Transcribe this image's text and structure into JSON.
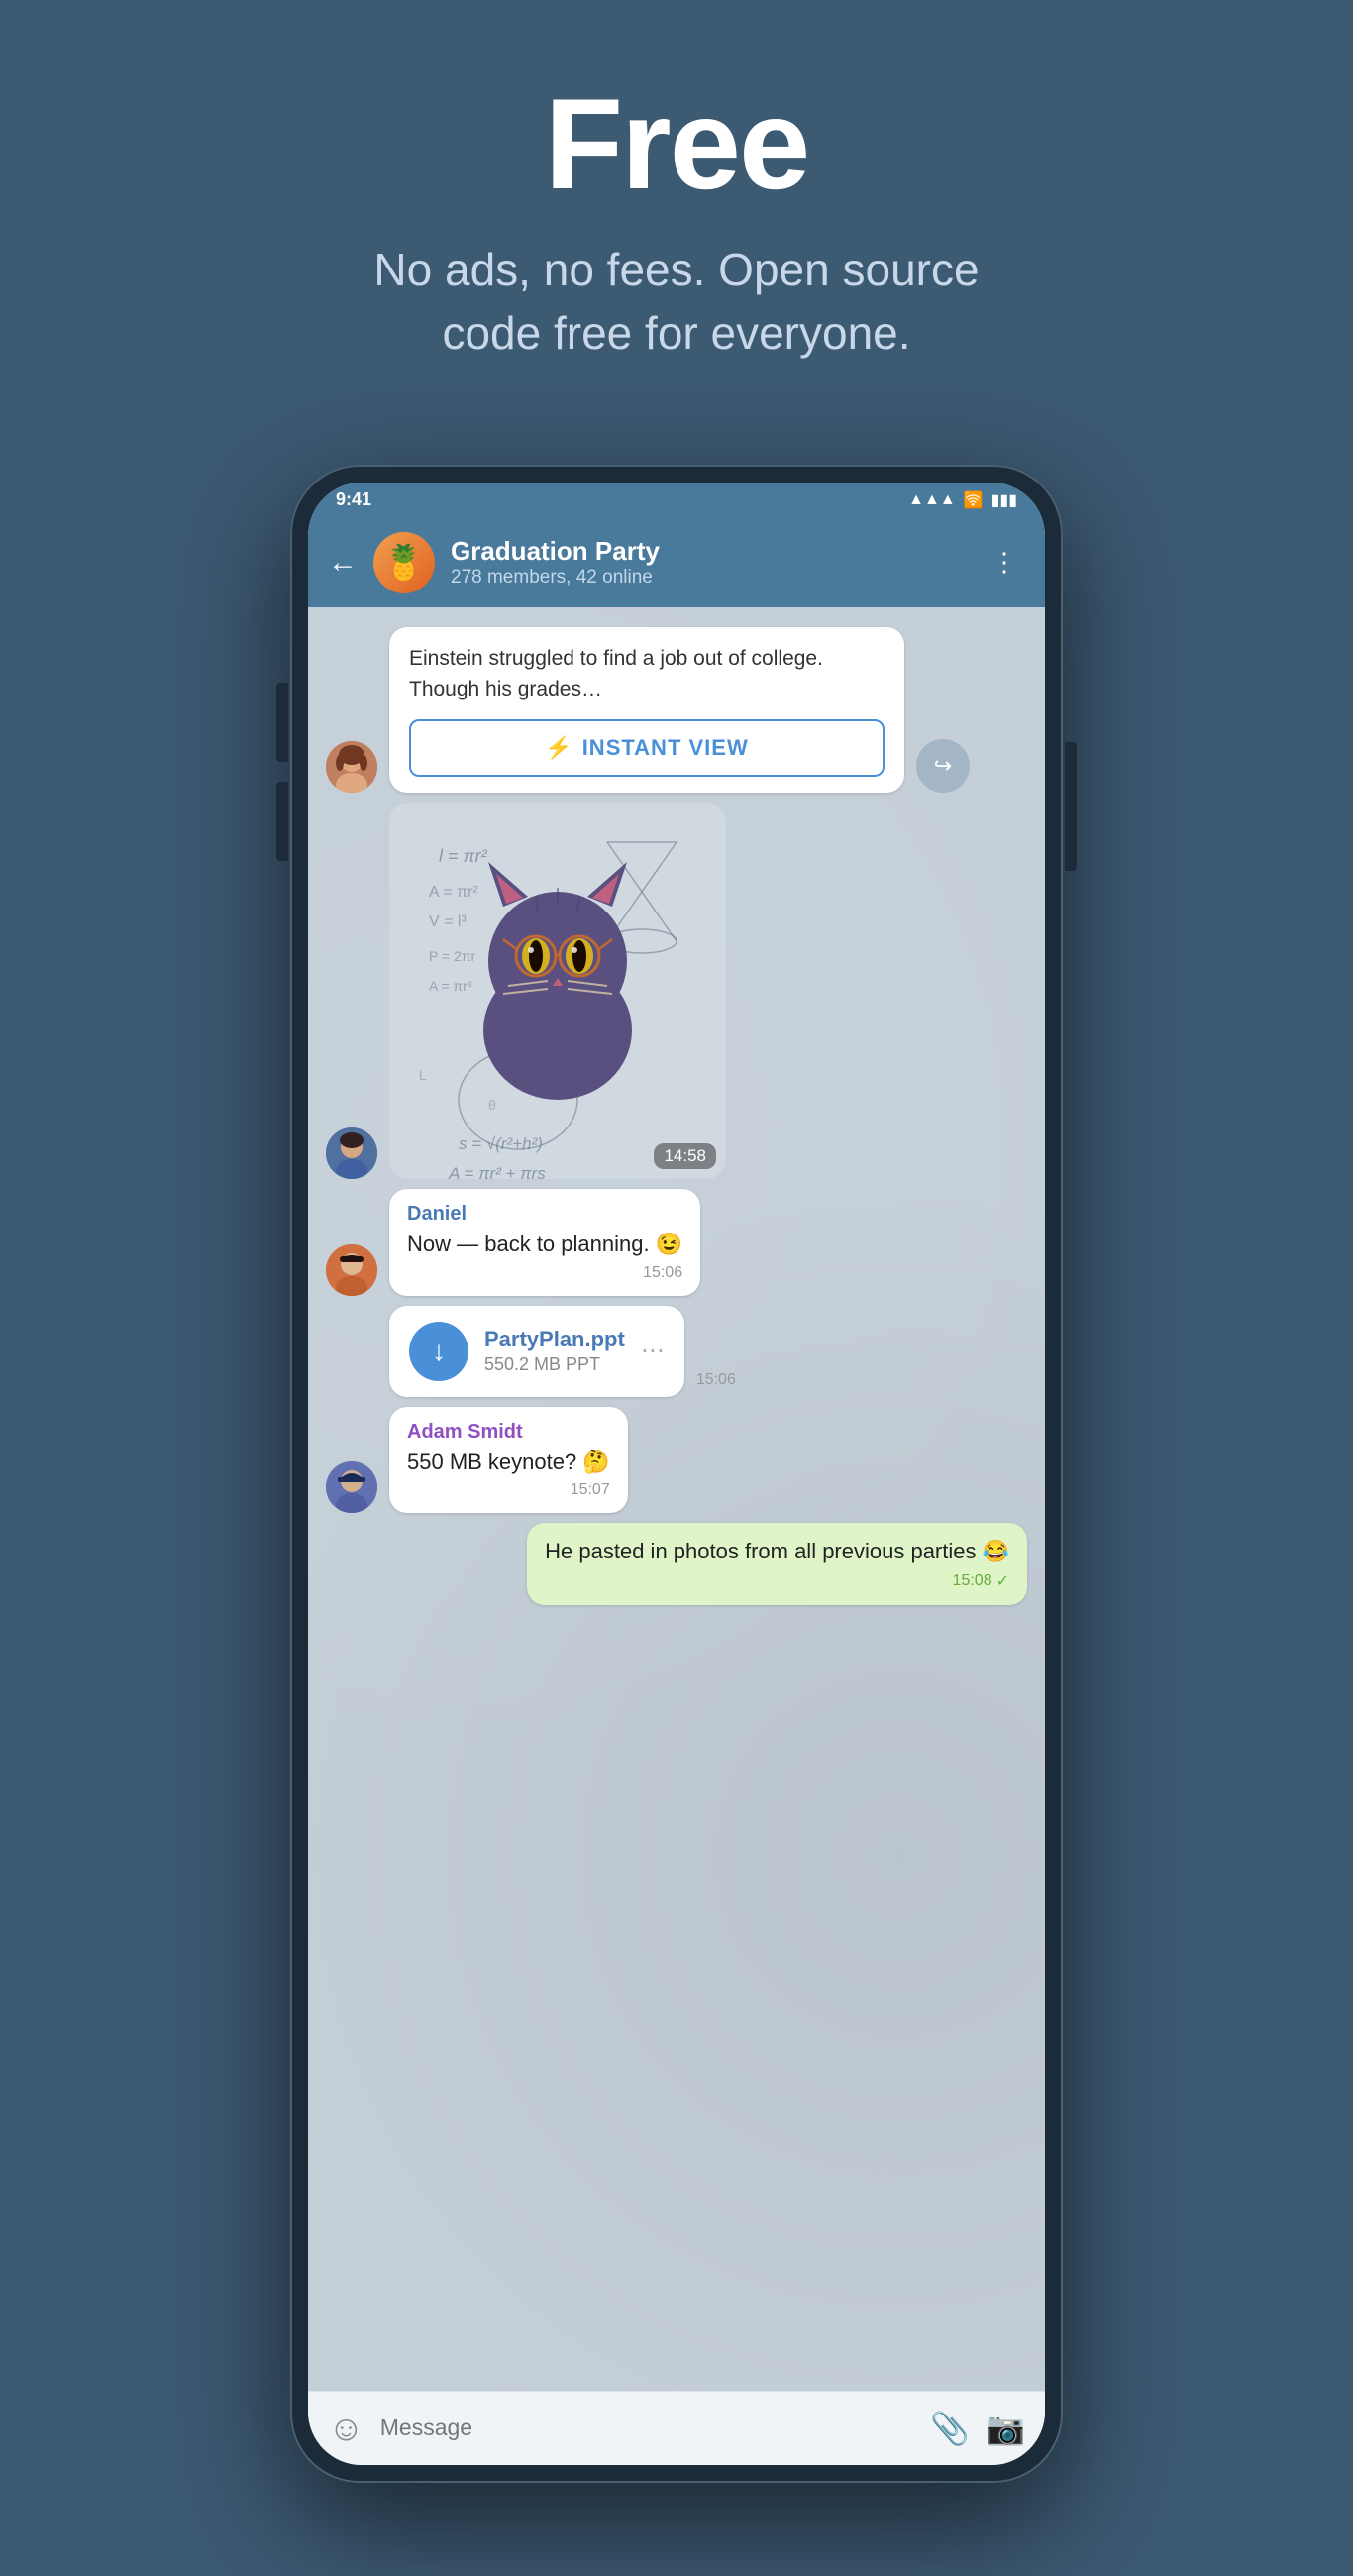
{
  "hero": {
    "title": "Free",
    "subtitle": "No ads, no fees. Open source code free for everyone."
  },
  "phone": {
    "statusBar": {
      "time": "9:41",
      "icons": [
        "●●●",
        "WiFi",
        "Battery"
      ]
    },
    "chatHeader": {
      "groupName": "Graduation Party",
      "members": "278 members, 42 online",
      "backLabel": "←",
      "moreLabel": "⋮"
    },
    "messages": [
      {
        "id": "article-msg",
        "type": "article",
        "text": "Einstein struggled to find a job out of college. Though his grades…",
        "instantViewLabel": "INSTANT VIEW"
      },
      {
        "id": "sticker-msg",
        "type": "sticker",
        "time": "14:58"
      },
      {
        "id": "daniel-msg",
        "type": "text",
        "sender": "Daniel",
        "text": "Now — back to planning. 😉",
        "time": "15:06"
      },
      {
        "id": "file-msg",
        "type": "file",
        "fileName": "PartyPlan.ppt",
        "fileSize": "550.2 MB PPT",
        "time": "15:06"
      },
      {
        "id": "adam-msg",
        "type": "text",
        "sender": "Adam Smidt",
        "text": "550 MB keynote? 🤔",
        "time": "15:07"
      },
      {
        "id": "self-msg",
        "type": "self",
        "text": "He pasted in photos from all previous parties 😂",
        "time": "15:08"
      }
    ],
    "inputBar": {
      "placeholder": "Message"
    }
  }
}
